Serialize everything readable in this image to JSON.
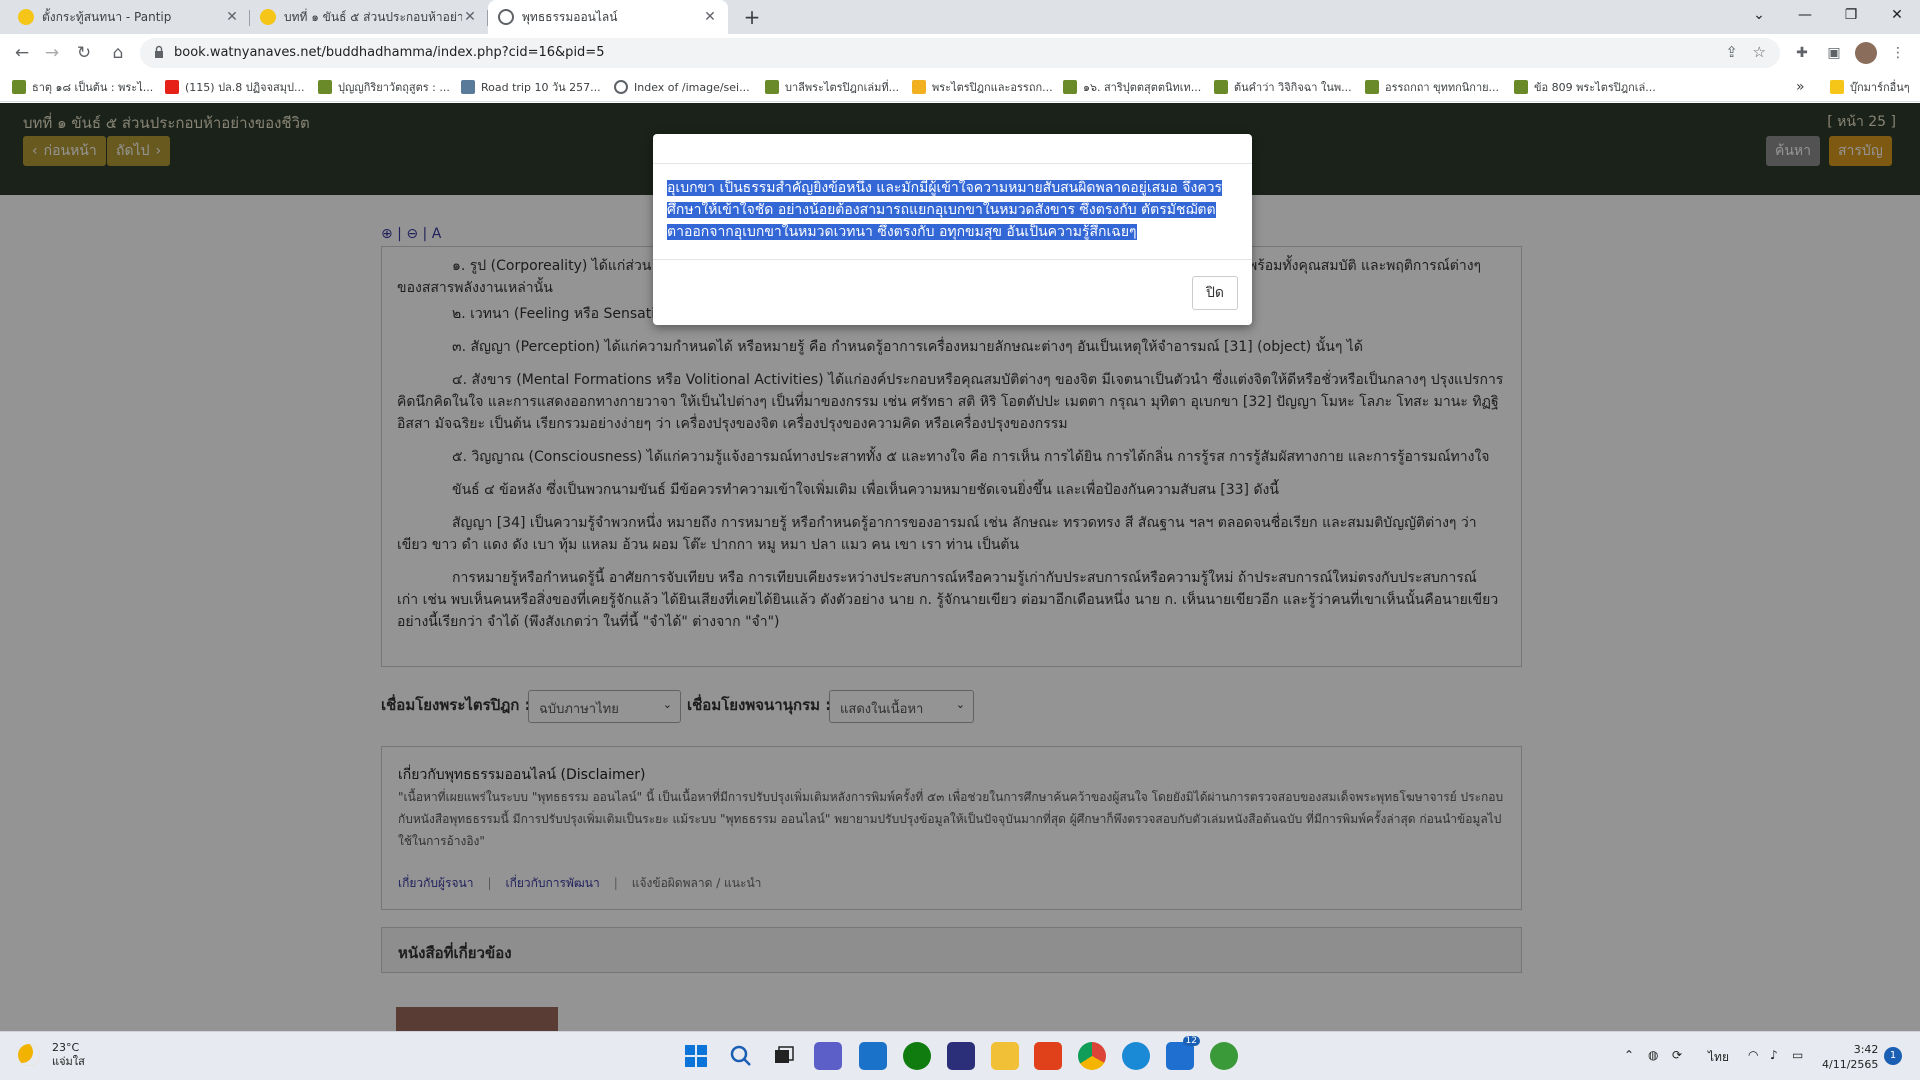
{
  "browser": {
    "tabs": [
      {
        "title": "ตั้งกระทู้สนทนา - Pantip",
        "active": false
      },
      {
        "title": "บทที่ ๑ ขันธ์ ๕ ส่วนประกอบห้าอย่างข",
        "active": false
      },
      {
        "title": "พุทธธรรมออนไลน์",
        "active": true
      }
    ],
    "url": "book.watnyanaves.net/buddhadhamma/index.php?cid=16&pid=5",
    "bookmarks": [
      "ธาตุ ๑๘ เป็นต้น : พระไ...",
      "(115) ปล.8 ปฏิจจสมุป...",
      "ปุญญกิริยาวัตถุสูตร : ...",
      "Road trip 10 วัน 257...",
      "Index of /image/sei...",
      "บาลีพระไตรปิฎกเล่มที่...",
      "พระไตรปิฎกและอรรถก...",
      "๑๖. สาริปุตตสุตตนิทเท...",
      "ต้นคำว่า วิจิกิจฉา ในพ...",
      "อรรถกถา ขุททกนิกาย...",
      "ข้อ 809 พระไตรปิฎกเล่..."
    ],
    "bookmarks_more": "»",
    "bookmarks_folder": "บุ๊กมาร์กอื่นๆ"
  },
  "page": {
    "chapter_title": "บทที่ ๑ ขันธ์ ๕ ส่วนประกอบห้าอย่างของชีวิต",
    "page_label": "[ หน้า 25 ]",
    "prev_label": "ก่อนหน้า",
    "next_label": "ถัดไป",
    "search_label": "ค้นหา",
    "toc_label": "สารบัญ",
    "zoom_tools": "⊕ | ⊖ | A",
    "paragraphs": [
      {
        "text": "๑. รูป (Corporeality) ได้แก่ส่วน",
        "tail": "พร้อมทั้งคุณสมบัติ และพฤติการณ์ต่างๆ",
        "line2": "ของสสารพลังงานเหล่านั้น"
      },
      {
        "text": "๒. เวทนา (Feeling หรือ Sensation) ได้แก่ความรู้สึกสุข ทุกข์ หรือเฉยๆ ซึ่งเกิดจากผัสสะทางประสาททั้ง ๕ และทางใจ"
      },
      {
        "text": "๓. สัญญา (Perception) ได้แก่ความกำหนดได้ หรือหมายรู้ คือ กำหนดรู้อาการเครื่องหมายลักษณะต่างๆ อันเป็นเหตุให้จำอารมณ์ [31] (object) นั้นๆ ได้"
      },
      {
        "text": "๔. สังขาร (Mental Formations หรือ Volitional Activities) ได้แก่องค์ประกอบหรือคุณสมบัติต่างๆ ของจิต มีเจตนาเป็นตัวนำ ซึ่งแต่งจิตให้ดีหรือชั่วหรือเป็นกลางๆ ปรุงแปรการ",
        "line2": "คิดนึกคิดในใจ และการแสดงออกทางกายวาจา ให้เป็นไปต่างๆ เป็นที่มาของกรรม เช่น ศรัทธา สติ หิริ โอตตัปปะ เมตตา กรุณา มุทิตา อุเบกขา [32] ปัญญา โมหะ โลภะ โทสะ มานะ ทิฏฐิ",
        "line3": "อิสสา มัจฉริยะ เป็นต้น เรียกรวมอย่างง่ายๆ ว่า เครื่องปรุงของจิต เครื่องปรุงของความคิด หรือเครื่องปรุงของกรรม"
      },
      {
        "text": "๕. วิญญาณ (Consciousness) ได้แก่ความรู้แจ้งอารมณ์ทางประสาททั้ง ๕ และทางใจ คือ การเห็น การได้ยิน การได้กลิ่น การรู้รส การรู้สัมผัสทางกาย และการรู้อารมณ์ทางใจ"
      },
      {
        "text": "ขันธ์ ๔ ข้อหลัง ซึ่งเป็นพวกนามขันธ์ มีข้อควรทำความเข้าใจเพิ่มเติม เพื่อเห็นความหมายชัดเจนยิ่งขึ้น และเพื่อป้องกันความสับสน [33] ดังนี้"
      },
      {
        "text": "สัญญา [34] เป็นความรู้จำพวกหนึ่ง หมายถึง การหมายรู้ หรือกำหนดรู้อาการของอารมณ์ เช่น ลักษณะ ทรวดทรง สี สัณฐาน ฯลฯ ตลอดจนชื่อเรียก และสมมติบัญญัติต่างๆ ว่า",
        "line2": "เขียว ขาว ดำ แดง ดัง เบา ทุ้ม แหลม อ้วน ผอม โต๊ะ ปากกา หมู หมา ปลา แมว คน เขา เรา ท่าน เป็นต้น"
      },
      {
        "text": "การหมายรู้หรือกำหนดรู้นี้ อาศัยการจับเทียบ หรือ การเทียบเคียงระหว่างประสบการณ์หรือความรู้เก่ากับประสบการณ์หรือความรู้ใหม่ ถ้าประสบการณ์ใหม่ตรงกับประสบการณ์",
        "line2": "เก่า เช่น พบเห็นคนหรือสิ่งของที่เคยรู้จักแล้ว ได้ยินเสียงที่เคยได้ยินแล้ว ดังตัวอย่าง นาย ก. รู้จักนายเขียว ต่อมาอีกเดือนหนึ่ง นาย ก. เห็นนายเขียวอีก และรู้ว่าคนที่เขาเห็นนั้นคือนายเขียว",
        "line3": "อย่างนี้เรียกว่า จำได้ (พึงสังเกตว่า ในที่นี้ \"จำได้\" ต่างจาก \"จำ\")"
      }
    ],
    "link_tipitaka_label": "เชื่อมโยงพระไตรปิฎก :",
    "tipitaka_select": "ฉบับภาษาไทย",
    "link_dict_label": "เชื่อมโยงพจนานุกรม :",
    "dict_select": "แสดงในเนื้อหา",
    "disclaimer_title": "เกี่ยวกับพุทธธรรมออนไลน์ (Disclaimer)",
    "disclaimer_text": "\"เนื้อหาที่เผยแพร่ในระบบ \"พุทธธรรม ออนไลน์\" นี้ เป็นเนื้อหาที่มีการปรับปรุงเพิ่มเติมหลังการพิมพ์ครั้งที่ ๕๓ เพื่อช่วยในการศึกษาค้นคว้าของผู้สนใจ โดยยังมิได้ผ่านการตรวจสอบของสมเด็จพระพุทธโฆษาจารย์ ประกอบกับหนังสือพุทธธรรมนี้ มีการปรับปรุงเพิ่มเติมเป็นระยะ แม้ระบบ \"พุทธธรรม ออนไลน์\" พยายามปรับปรุงข้อมูลให้เป็นปัจจุบันมากที่สุด ผู้ศึกษาก็พึงตรวจสอบกับตัวเล่มหนังสือต้นฉบับ ที่มีการพิมพ์ครั้งล่าสุด ก่อนนำข้อมูลไปใช้ในการอ้างอิง\"",
    "disclaimer_links": [
      "เกี่ยวกับผู้รจนา",
      "เกี่ยวกับการพัฒนา",
      "แจ้งข้อผิดพลาด / แนะนำ"
    ],
    "related_title": "หนังสือที่เกี่ยวข้อง"
  },
  "modal": {
    "body": "อุเบกขา เป็นธรรมสำคัญยิ่งข้อหนึ่ง และมักมีผู้เข้าใจความหมายสับสนผิดพลาดอยู่เสมอ จึงควรศึกษาให้เข้าใจชัด อย่างน้อยต้องสามารถแยกอุเบกขาในหมวดสังขาร ซึ่งตรงกับ ตัตรมัชฌัตตตาออกจากอุเบกขาในหมวดเวทนา ซึ่งตรงกับ อทุกขมสุข อันเป็นความรู้สึกเฉยๆ",
    "close_label": "ปิด"
  },
  "taskbar": {
    "temp": "23°C",
    "weather": "แจ่มใส",
    "lang": "ไทย",
    "time": "3:42",
    "date": "4/11/2565",
    "notification_count": "1",
    "badge_count": "12"
  },
  "colors": {
    "site_header": "#2d3b2c",
    "olive_button": "#b39a35",
    "toc_button": "#d9991e",
    "selection": "#3367d6"
  }
}
